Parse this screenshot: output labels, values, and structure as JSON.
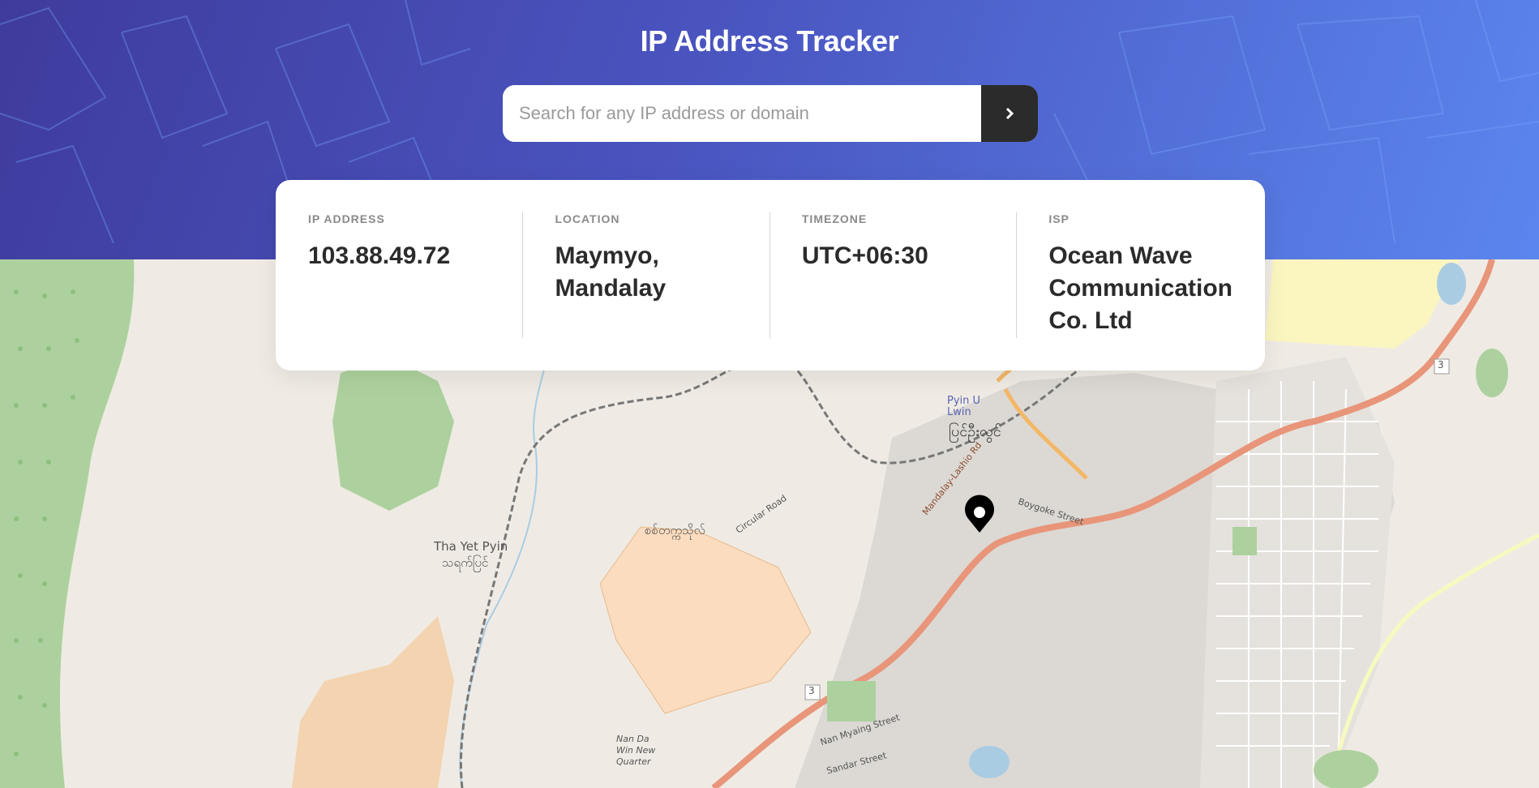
{
  "app": {
    "title": "IP Address Tracker"
  },
  "search": {
    "placeholder": "Search for any IP address or domain",
    "value": "",
    "button_icon": "chevron-right-icon"
  },
  "info": [
    {
      "label": "IP ADDRESS",
      "value": "103.88.49.72"
    },
    {
      "label": "LOCATION",
      "value": "Maymyo, Mandalay"
    },
    {
      "label": "TIMEZONE",
      "value": "UTC+06:30"
    },
    {
      "label": "ISP",
      "value": "Ocean Wave Communication Co. Ltd"
    }
  ],
  "map": {
    "marker_icon": "location-pin-icon",
    "labels": {
      "town": "Pyin U Lwin",
      "town_local": "ပြင်ဦးလွင်",
      "village": "Tha Yet Pyin",
      "village_local": "သရက်ပြင်",
      "military": "စစ်တက္ကသိုလ်",
      "circular_road": "Circular Road",
      "mandalay_lashio": "Mandalay-Lashio Rd",
      "boygoke": "Boygoke Street",
      "nan_myaing": "Nan Myaing Street",
      "sandar": "Sandar Street",
      "nan_da_win": "Nan Da Win New Quarter",
      "route_shield_1": "3",
      "route_shield_2": "3"
    }
  },
  "colors": {
    "header_start": "#3f3b9c",
    "header_end": "#5b86ee",
    "button": "#2b2b2b",
    "road_primary": "#e8957a",
    "forest": "#add19e"
  }
}
